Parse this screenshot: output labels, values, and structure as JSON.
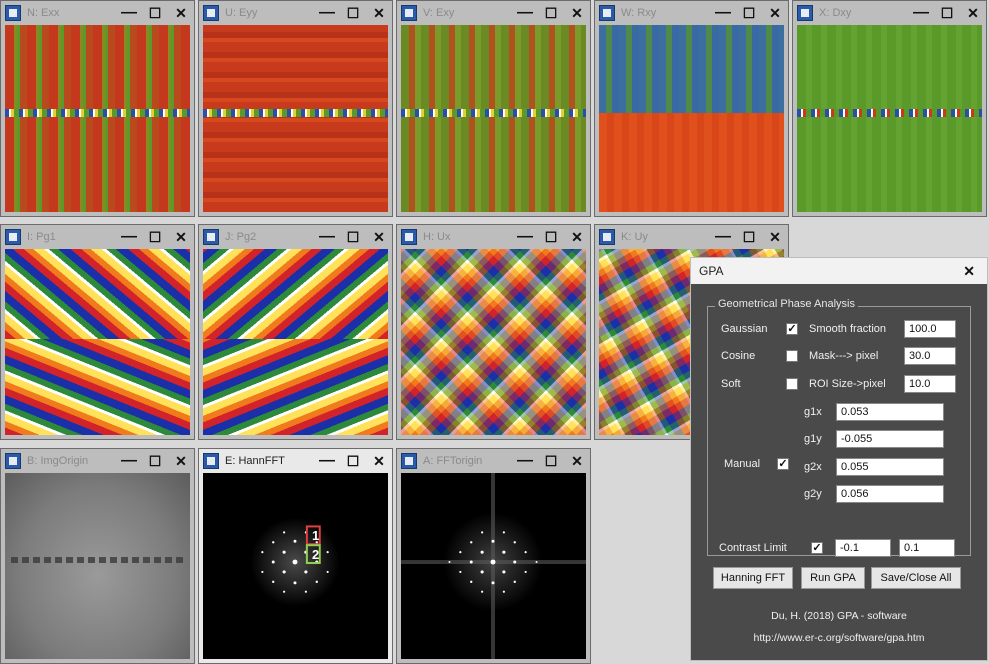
{
  "windows": {
    "exx": {
      "title": "N: Exx"
    },
    "eyy": {
      "title": "U: Eyy"
    },
    "exy": {
      "title": "V: Exy"
    },
    "rxy": {
      "title": "W: Rxy"
    },
    "dxy": {
      "title": "X: Dxy"
    },
    "pg1": {
      "title": "I: Pg1"
    },
    "pg2": {
      "title": "J: Pg2"
    },
    "ux": {
      "title": "H: Ux"
    },
    "uy": {
      "title": "K: Uy"
    },
    "img_origin": {
      "title": "B: ImgOrigin"
    },
    "hann_fft": {
      "title": "E: HannFFT",
      "marker_1": "1",
      "marker_2": "2"
    },
    "fft_origin": {
      "title": "A: FFTorigin"
    }
  },
  "window_controls": {
    "minimize": "—",
    "maximize": "☐",
    "close": "✕"
  },
  "gpa": {
    "title": "GPA",
    "close": "✕",
    "group_label": "Geometrical Phase Analysis",
    "options": [
      {
        "label": "Gaussian",
        "checked": true,
        "param_label": "Smooth fraction",
        "value": "100.0"
      },
      {
        "label": "Cosine",
        "checked": false,
        "param_label": "Mask---> pixel",
        "value": "30.0"
      },
      {
        "label": "Soft",
        "checked": false,
        "param_label": "ROI Size->pixel",
        "value": "10.0"
      }
    ],
    "manual": {
      "label": "Manual",
      "checked": true
    },
    "gvectors": [
      {
        "label": "g1x",
        "value": "0.053"
      },
      {
        "label": "g1y",
        "value": "-0.055"
      },
      {
        "label": "g2x",
        "value": "0.055"
      },
      {
        "label": "g2y",
        "value": "0.056"
      }
    ],
    "contrast_limit": {
      "label": "Contrast Limit",
      "checked": true,
      "min": "-0.1",
      "max": "0.1"
    },
    "buttons": {
      "hanning_fft": "Hanning FFT",
      "run_gpa": "Run GPA",
      "save_close": "Save/Close All"
    },
    "citation": "Du, H. (2018) GPA - software",
    "url": "http://www.er-c.org/software/gpa.htm"
  },
  "colors": {
    "strain_red": "#c8341c",
    "strain_green": "#5a9a2a",
    "strain_blue": "#2a4fa8",
    "dialog_bg": "#4a4a4a"
  }
}
